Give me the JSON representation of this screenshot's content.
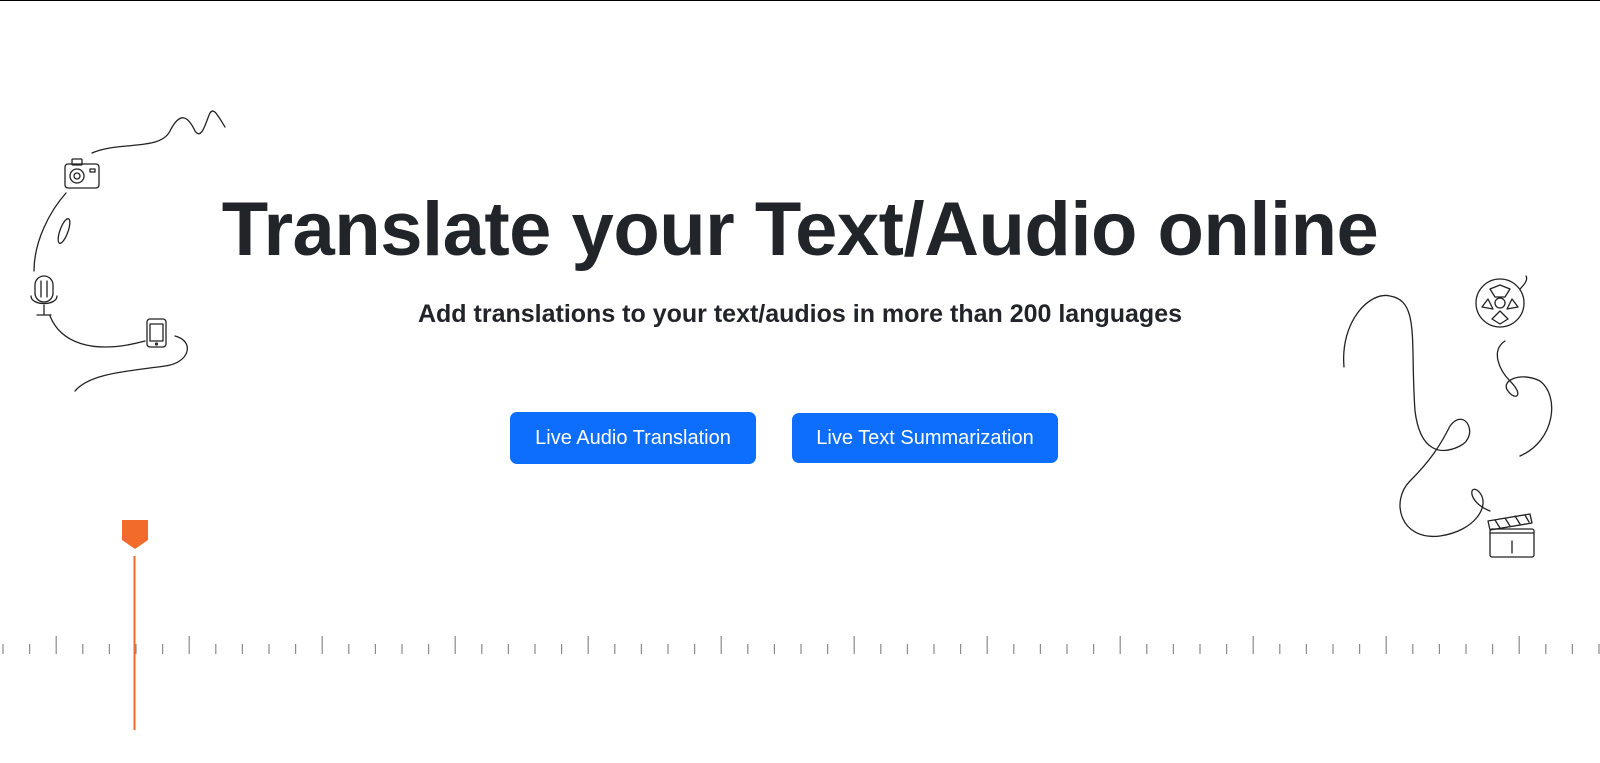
{
  "hero": {
    "title": "Translate your Text/Audio online",
    "subtitle": "Add translations to your text/audios in more than 200 languages"
  },
  "actions": {
    "audio_translation_label": "Live Audio Translation",
    "text_summarization_label": "Live Text Summarization"
  },
  "decor": {
    "left_icons": [
      "camera-icon",
      "microphone-icon",
      "smartphone-icon"
    ],
    "right_icons": [
      "film-reel-icon",
      "clapperboard-icon"
    ],
    "timeline_icons": [
      "playhead-marker-icon"
    ]
  },
  "colors": {
    "primary": "#0d6efd",
    "text": "#212529",
    "playhead": "#f26b2a",
    "ruler": "#8a8a8a"
  }
}
